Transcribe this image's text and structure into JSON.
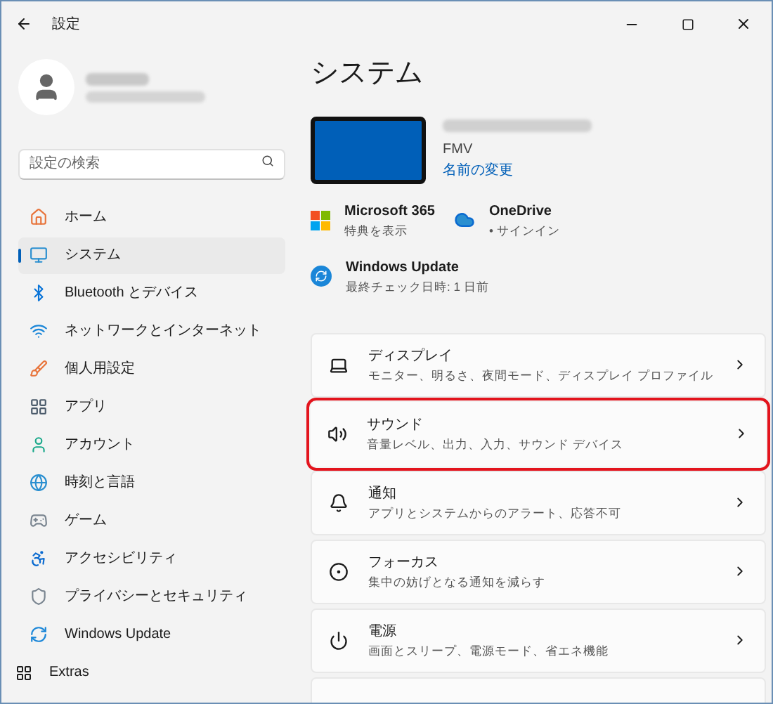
{
  "window": {
    "title": "設定"
  },
  "search": {
    "placeholder": "設定の検索"
  },
  "sidebar": {
    "items": [
      {
        "label": "ホーム",
        "selected": false
      },
      {
        "label": "システム",
        "selected": true
      },
      {
        "label": "Bluetooth とデバイス",
        "selected": false
      },
      {
        "label": "ネットワークとインターネット",
        "selected": false
      },
      {
        "label": "個人用設定",
        "selected": false
      },
      {
        "label": "アプリ",
        "selected": false
      },
      {
        "label": "アカウント",
        "selected": false
      },
      {
        "label": "時刻と言語",
        "selected": false
      },
      {
        "label": "ゲーム",
        "selected": false
      },
      {
        "label": "アクセシビリティ",
        "selected": false
      },
      {
        "label": "プライバシーとセキュリティ",
        "selected": false
      },
      {
        "label": "Windows Update",
        "selected": false
      }
    ],
    "extras": "Extras"
  },
  "page_title": "システム",
  "device": {
    "model": "FMV",
    "rename_link": "名前の変更"
  },
  "tiles": [
    {
      "title": "Microsoft 365",
      "subtitle": "特典を表示"
    },
    {
      "title": "OneDrive",
      "subtitle": "• サインイン"
    },
    {
      "title": "Windows Update",
      "subtitle": "最終チェック日時: 1 日前"
    }
  ],
  "settings": [
    {
      "title": "ディスプレイ",
      "subtitle": "モニター、明るさ、夜間モード、ディスプレイ プロファイル",
      "highlighted": false
    },
    {
      "title": "サウンド",
      "subtitle": "音量レベル、出力、入力、サウンド デバイス",
      "highlighted": true
    },
    {
      "title": "通知",
      "subtitle": "アプリとシステムからのアラート、応答不可",
      "highlighted": false
    },
    {
      "title": "フォーカス",
      "subtitle": "集中の妨げとなる通知を減らす",
      "highlighted": false
    },
    {
      "title": "電源",
      "subtitle": "画面とスリープ、電源モード、省エネ機能",
      "highlighted": false
    }
  ]
}
